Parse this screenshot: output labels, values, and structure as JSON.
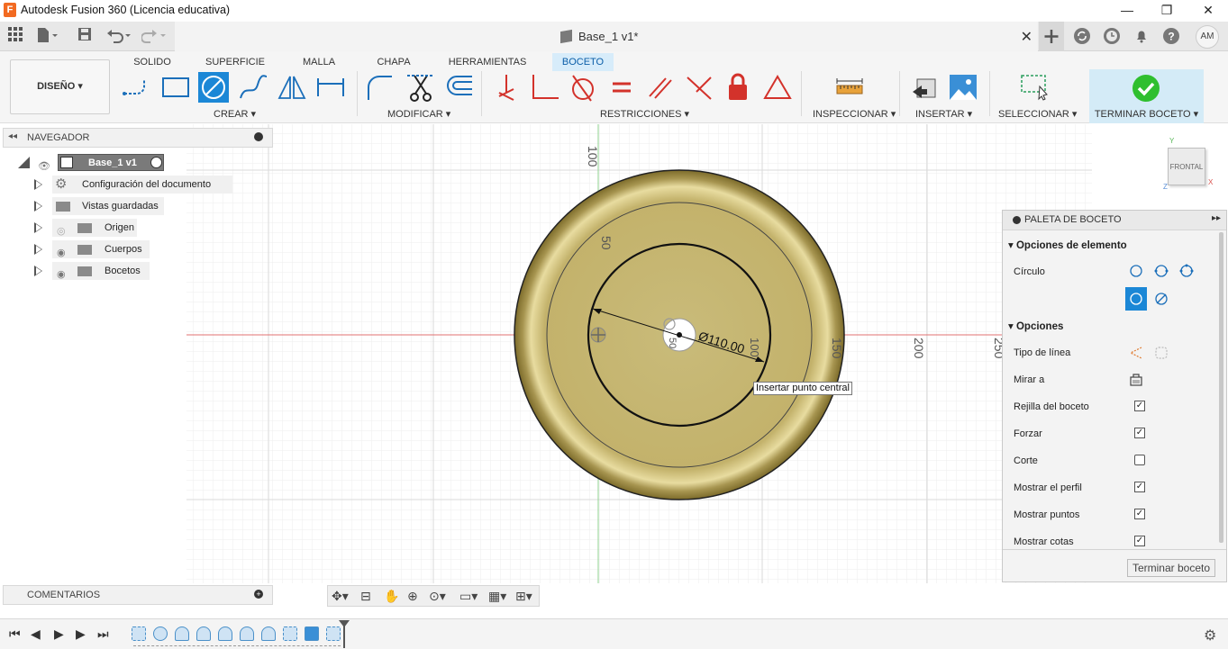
{
  "app": {
    "title": "Autodesk Fusion 360 (Licencia educativa)",
    "icon_letter": "F"
  },
  "window_controls": {
    "minimize": "—",
    "maximize": "❐",
    "close": "✕"
  },
  "document_tab": {
    "title": "Base_1 v1*",
    "close": "✕"
  },
  "user": {
    "initials": "AM"
  },
  "ribbon": {
    "tabs": [
      "SOLIDO",
      "SUPERFICIE",
      "MALLA",
      "CHAPA",
      "HERRAMIENTAS",
      "BOCETO"
    ],
    "active_tab": "BOCETO",
    "workspace": "DISEÑO ▾",
    "groups": {
      "create": "CREAR ▾",
      "modify": "MODIFICAR ▾",
      "constraints": "RESTRICCIONES ▾",
      "inspect": "INSPECCIONAR ▾",
      "insert": "INSERTAR ▾",
      "select": "SELECCIONAR ▾",
      "finish": "TERMINAR BOCETO ▾"
    }
  },
  "navigator": {
    "title": "NAVEGADOR",
    "root": "Base_1 v1",
    "items": [
      "Configuración del documento",
      "Vistas guardadas",
      "Origen",
      "Cuerpos",
      "Bocetos"
    ]
  },
  "comments": {
    "title": "COMENTARIOS"
  },
  "viewcube": {
    "face": "FRONTAL",
    "axis_y": "Y",
    "axis_x": "X",
    "axis_z": "Z"
  },
  "canvas": {
    "ruler_labels": [
      "100",
      "50",
      "150",
      "200",
      "250",
      "50",
      "100"
    ],
    "dimension": "Ø110.00",
    "tooltip": "Insertar punto central"
  },
  "palette": {
    "title": "PALETA DE BOCETO",
    "section_element": "Opciones de elemento",
    "circle_label": "Círculo",
    "section_options": "Opciones",
    "options": [
      {
        "label": "Tipo de línea",
        "type": "icons"
      },
      {
        "label": "Mirar a",
        "type": "icon"
      },
      {
        "label": "Rejilla del boceto",
        "checked": true
      },
      {
        "label": "Forzar",
        "checked": true
      },
      {
        "label": "Corte",
        "checked": false
      },
      {
        "label": "Mostrar el perfil",
        "checked": true
      },
      {
        "label": "Mostrar puntos",
        "checked": true
      },
      {
        "label": "Mostrar cotas",
        "checked": true
      }
    ],
    "finish_button": "Terminar boceto"
  },
  "colors": {
    "accent": "#1b87d6",
    "finish_green": "#2fbf2f",
    "body_gold": "#c7b56f",
    "axis_red": "#e06060",
    "axis_green": "#7fc97f"
  }
}
